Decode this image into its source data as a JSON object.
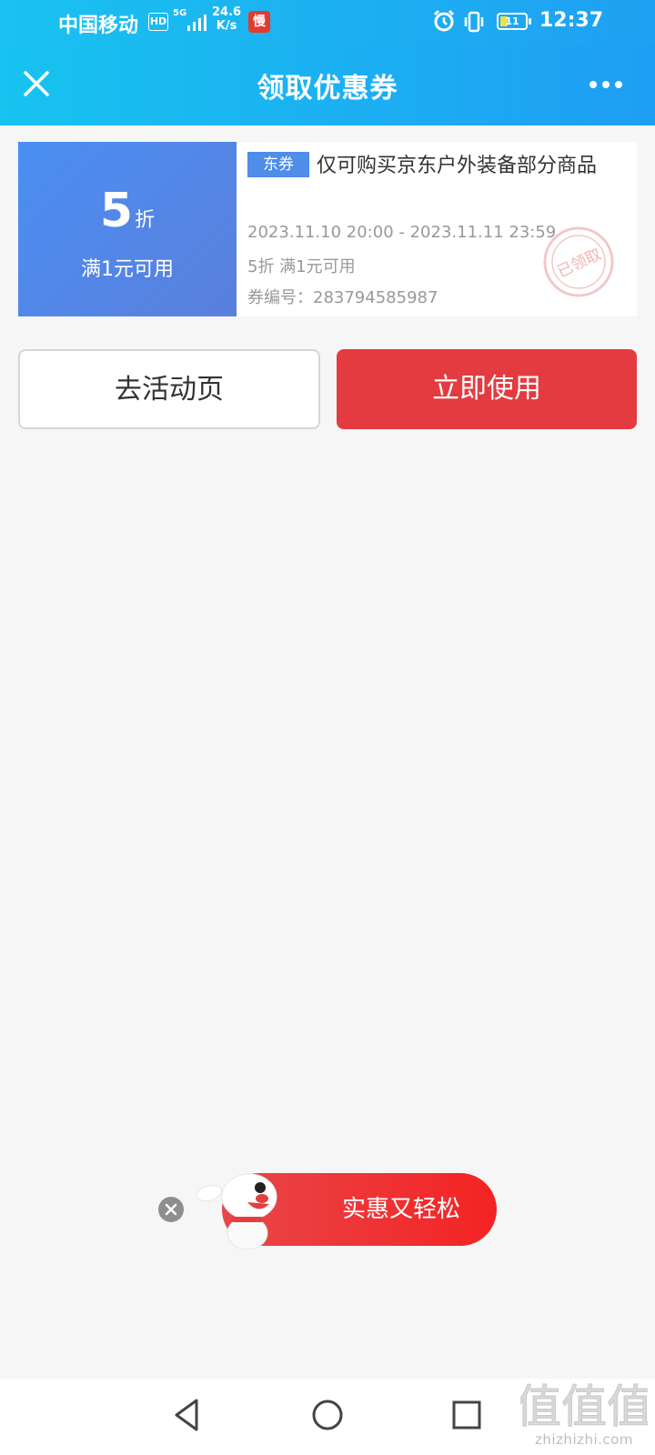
{
  "status_bar": {
    "carrier": "中国移动",
    "hd_badge": "HD",
    "network": "5G",
    "speed_value": "24.6",
    "speed_unit": "K/s",
    "app_badge": "慢",
    "battery_level": "11",
    "time": "12:37",
    "icons": [
      "signal-icon",
      "alarm-icon",
      "vibrate-icon",
      "battery-icon"
    ]
  },
  "header": {
    "title": "领取优惠券",
    "close_icon": "close-icon",
    "more_icon": "more-icon"
  },
  "coupon": {
    "discount_value": "5",
    "discount_unit": "折",
    "condition": "满1元可用",
    "tag": "东券",
    "description": "仅可购买京东户外装备部分商品",
    "validity": "2023.11.10 20:00 - 2023.11.11 23:59",
    "rule": "5折 满1元可用",
    "code_label": "券编号：",
    "code": "283794585987",
    "stamp_text": "已领取",
    "colors": {
      "left_gradient_start": "#4a8ff3",
      "left_gradient_end": "#5b7fdc",
      "tag": "#4e8de8"
    }
  },
  "actions": {
    "activity_button": "去活动页",
    "use_button": "立即使用",
    "use_button_color": "#e33b3f"
  },
  "promo": {
    "text": "实惠又轻松",
    "close_icon": "close-icon",
    "mascot": "joy-dog-mascot"
  },
  "nav_bar": {
    "icons": [
      "back-icon",
      "home-icon",
      "recent-apps-icon"
    ]
  },
  "watermark": {
    "glyphs": "值值值",
    "text": "zhizhizhi.com"
  }
}
